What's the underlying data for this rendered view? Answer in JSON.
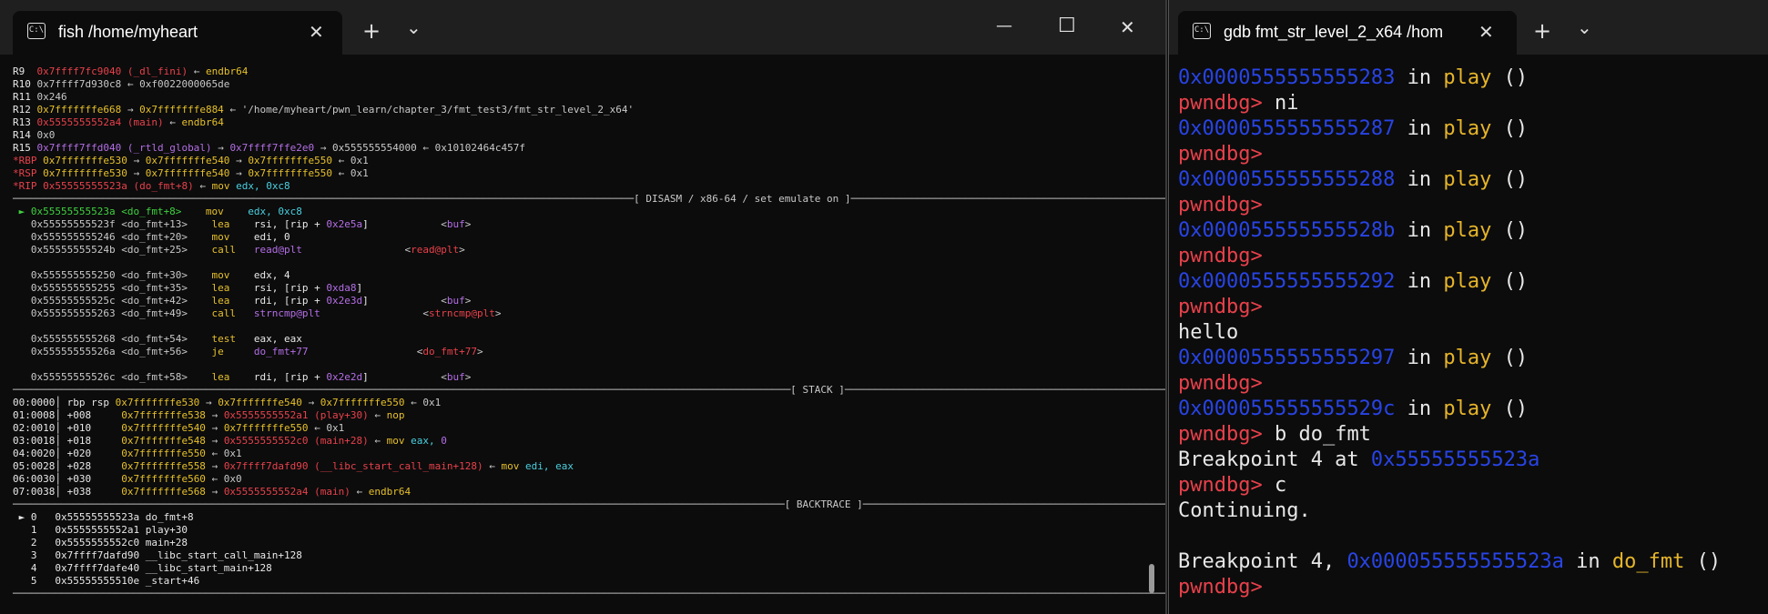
{
  "left_window": {
    "tab_title": "fish /home/myheart",
    "tab_icon": "terminal-icon",
    "tab_icon_text": "C:\\",
    "new_tab_label": "+",
    "dropdown_label": "⌄",
    "minimize_label": "—",
    "maximize_label": "☐",
    "close_label": "✕",
    "lines": [
      [
        {
          "t": "R9  ",
          "c": "white"
        },
        {
          "t": "0x7ffff7fc9040 (_dl_fini)",
          "c": "red"
        },
        {
          "t": " ← ",
          "c": "gray"
        },
        {
          "t": "endbr64",
          "c": "yellow"
        }
      ],
      [
        {
          "t": "R10 ",
          "c": "white"
        },
        {
          "t": "0x7ffff7d930c8 ← 0xf0022000065de",
          "c": "gray"
        }
      ],
      [
        {
          "t": "R11 ",
          "c": "white"
        },
        {
          "t": "0x246",
          "c": "gray"
        }
      ],
      [
        {
          "t": "R12 ",
          "c": "white"
        },
        {
          "t": "0x7fffffffe668",
          "c": "yellow"
        },
        {
          "t": " → ",
          "c": "gray"
        },
        {
          "t": "0x7fffffffe884",
          "c": "yellow"
        },
        {
          "t": " ← '/home/myheart/pwn_learn/chapter_3/fmt_test3/fmt_str_level_2_x64'",
          "c": "gray"
        }
      ],
      [
        {
          "t": "R13 ",
          "c": "white"
        },
        {
          "t": "0x5555555552a4 (main)",
          "c": "red"
        },
        {
          "t": " ← ",
          "c": "gray"
        },
        {
          "t": "endbr64",
          "c": "yellow"
        }
      ],
      [
        {
          "t": "R14 ",
          "c": "white"
        },
        {
          "t": "0x0",
          "c": "gray"
        }
      ],
      [
        {
          "t": "R15 ",
          "c": "white"
        },
        {
          "t": "0x7ffff7ffd040 (_rtld_global)",
          "c": "purple"
        },
        {
          "t": " → ",
          "c": "gray"
        },
        {
          "t": "0x7ffff7ffe2e0",
          "c": "purple"
        },
        {
          "t": " → 0x555555554000 ← 0x10102464c457f",
          "c": "gray"
        }
      ],
      [
        {
          "t": "*RBP ",
          "c": "red"
        },
        {
          "t": "0x7fffffffe530",
          "c": "yellow"
        },
        {
          "t": " → ",
          "c": "gray"
        },
        {
          "t": "0x7fffffffe540",
          "c": "yellow"
        },
        {
          "t": " → ",
          "c": "gray"
        },
        {
          "t": "0x7fffffffe550",
          "c": "yellow"
        },
        {
          "t": " ← 0x1",
          "c": "gray"
        }
      ],
      [
        {
          "t": "*RSP ",
          "c": "red"
        },
        {
          "t": "0x7fffffffe530",
          "c": "yellow"
        },
        {
          "t": " → ",
          "c": "gray"
        },
        {
          "t": "0x7fffffffe540",
          "c": "yellow"
        },
        {
          "t": " → ",
          "c": "gray"
        },
        {
          "t": "0x7fffffffe550",
          "c": "yellow"
        },
        {
          "t": " ← 0x1",
          "c": "gray"
        }
      ],
      [
        {
          "t": "*RIP ",
          "c": "red"
        },
        {
          "t": "0x55555555523a (do_fmt+8)",
          "c": "red"
        },
        {
          "t": " ← ",
          "c": "gray"
        },
        {
          "t": "mov ",
          "c": "yellow"
        },
        {
          "t": "edx, 0xc8",
          "c": "cyan"
        }
      ],
      [
        {
          "t": "───────────────────────────────────────────────────────────────────────────────────────────────────────[ DISASM / x86-64 / set emulate on ]─────────────────────────────────────────────────────────────────────────────────────────────────",
          "c": "sep"
        }
      ],
      [
        {
          "t": " ► 0x55555555523a <do_fmt+8>    ",
          "c": "green"
        },
        {
          "t": "mov    ",
          "c": "yellow"
        },
        {
          "t": "edx, 0xc8",
          "c": "cyan"
        }
      ],
      [
        {
          "t": "   0x55555555523f <do_fmt+13>    ",
          "c": "gray"
        },
        {
          "t": "lea    ",
          "c": "yellow"
        },
        {
          "t": "rsi, [rip + ",
          "c": "white"
        },
        {
          "t": "0x2e5a",
          "c": "purple"
        },
        {
          "t": "]            ",
          "c": "white"
        },
        {
          "t": "<",
          "c": "gray"
        },
        {
          "t": "buf",
          "c": "purple"
        },
        {
          "t": ">",
          "c": "gray"
        }
      ],
      [
        {
          "t": "   0x555555555246 <do_fmt+20>    ",
          "c": "gray"
        },
        {
          "t": "mov    ",
          "c": "yellow"
        },
        {
          "t": "edi, 0",
          "c": "white"
        }
      ],
      [
        {
          "t": "   0x55555555524b <do_fmt+25>    ",
          "c": "gray"
        },
        {
          "t": "call   ",
          "c": "yellow"
        },
        {
          "t": "read@plt",
          "c": "purple"
        },
        {
          "t": "                 <",
          "c": "gray"
        },
        {
          "t": "read@plt",
          "c": "red"
        },
        {
          "t": ">",
          "c": "gray"
        }
      ],
      [
        {
          "t": " ",
          "c": "gray"
        }
      ],
      [
        {
          "t": "   0x555555555250 <do_fmt+30>    ",
          "c": "gray"
        },
        {
          "t": "mov    ",
          "c": "yellow"
        },
        {
          "t": "edx, 4",
          "c": "white"
        }
      ],
      [
        {
          "t": "   0x555555555255 <do_fmt+35>    ",
          "c": "gray"
        },
        {
          "t": "lea    ",
          "c": "yellow"
        },
        {
          "t": "rsi, [rip + ",
          "c": "white"
        },
        {
          "t": "0xda8",
          "c": "purple"
        },
        {
          "t": "]",
          "c": "white"
        }
      ],
      [
        {
          "t": "   0x55555555525c <do_fmt+42>    ",
          "c": "gray"
        },
        {
          "t": "lea    ",
          "c": "yellow"
        },
        {
          "t": "rdi, [rip + ",
          "c": "white"
        },
        {
          "t": "0x2e3d",
          "c": "purple"
        },
        {
          "t": "]            ",
          "c": "white"
        },
        {
          "t": "<",
          "c": "gray"
        },
        {
          "t": "buf",
          "c": "purple"
        },
        {
          "t": ">",
          "c": "gray"
        }
      ],
      [
        {
          "t": "   0x555555555263 <do_fmt+49>    ",
          "c": "gray"
        },
        {
          "t": "call   ",
          "c": "yellow"
        },
        {
          "t": "strncmp@plt",
          "c": "purple"
        },
        {
          "t": "                 <",
          "c": "gray"
        },
        {
          "t": "strncmp@plt",
          "c": "red"
        },
        {
          "t": ">",
          "c": "gray"
        }
      ],
      [
        {
          "t": " ",
          "c": "gray"
        }
      ],
      [
        {
          "t": "   0x555555555268 <do_fmt+54>    ",
          "c": "gray"
        },
        {
          "t": "test   ",
          "c": "yellow"
        },
        {
          "t": "eax, eax",
          "c": "white"
        }
      ],
      [
        {
          "t": "   0x55555555526a <do_fmt+56>    ",
          "c": "gray"
        },
        {
          "t": "je     ",
          "c": "yellow"
        },
        {
          "t": "do_fmt+77",
          "c": "purple"
        },
        {
          "t": "                  <",
          "c": "gray"
        },
        {
          "t": "do_fmt+77",
          "c": "red"
        },
        {
          "t": ">",
          "c": "gray"
        }
      ],
      [
        {
          "t": " ",
          "c": "gray"
        }
      ],
      [
        {
          "t": "   0x55555555526c <do_fmt+58>    ",
          "c": "gray"
        },
        {
          "t": "lea    ",
          "c": "yellow"
        },
        {
          "t": "rdi, [rip + ",
          "c": "white"
        },
        {
          "t": "0x2e2d",
          "c": "purple"
        },
        {
          "t": "]            ",
          "c": "white"
        },
        {
          "t": "<",
          "c": "gray"
        },
        {
          "t": "buf",
          "c": "purple"
        },
        {
          "t": ">",
          "c": "gray"
        }
      ],
      [
        {
          "t": "─────────────────────────────────────────────────────────────────────────────────────────────────────────────────────────────────[ STACK ]─────────────────────────────────────────────────────────────────────────────────────────────────────",
          "c": "sep"
        }
      ],
      [
        {
          "t": "00:0000│ rbp rsp ",
          "c": "white"
        },
        {
          "t": "0x7fffffffe530",
          "c": "yellow"
        },
        {
          "t": " → ",
          "c": "gray"
        },
        {
          "t": "0x7fffffffe540",
          "c": "yellow"
        },
        {
          "t": " → ",
          "c": "gray"
        },
        {
          "t": "0x7fffffffe550",
          "c": "yellow"
        },
        {
          "t": " ← 0x1",
          "c": "gray"
        }
      ],
      [
        {
          "t": "01:0008│ +008     ",
          "c": "white"
        },
        {
          "t": "0x7fffffffe538",
          "c": "yellow"
        },
        {
          "t": " → ",
          "c": "gray"
        },
        {
          "t": "0x5555555552a1 (play+30)",
          "c": "red"
        },
        {
          "t": " ← ",
          "c": "gray"
        },
        {
          "t": "nop",
          "c": "yellow"
        }
      ],
      [
        {
          "t": "02:0010│ +010     ",
          "c": "white"
        },
        {
          "t": "0x7fffffffe540",
          "c": "yellow"
        },
        {
          "t": " → ",
          "c": "gray"
        },
        {
          "t": "0x7fffffffe550",
          "c": "yellow"
        },
        {
          "t": " ← 0x1",
          "c": "gray"
        }
      ],
      [
        {
          "t": "03:0018│ +018     ",
          "c": "white"
        },
        {
          "t": "0x7fffffffe548",
          "c": "yellow"
        },
        {
          "t": " → ",
          "c": "gray"
        },
        {
          "t": "0x5555555552c0 (main+28)",
          "c": "red"
        },
        {
          "t": " ← ",
          "c": "gray"
        },
        {
          "t": "mov ",
          "c": "yellow"
        },
        {
          "t": "eax, ",
          "c": "cyan"
        },
        {
          "t": "0",
          "c": "purple"
        }
      ],
      [
        {
          "t": "04:0020│ +020     ",
          "c": "white"
        },
        {
          "t": "0x7fffffffe550",
          "c": "yellow"
        },
        {
          "t": " ← 0x1",
          "c": "gray"
        }
      ],
      [
        {
          "t": "05:0028│ +028     ",
          "c": "white"
        },
        {
          "t": "0x7fffffffe558",
          "c": "yellow"
        },
        {
          "t": " → ",
          "c": "gray"
        },
        {
          "t": "0x7ffff7dafd90 (__libc_start_call_main+128)",
          "c": "red"
        },
        {
          "t": " ← ",
          "c": "gray"
        },
        {
          "t": "mov ",
          "c": "yellow"
        },
        {
          "t": "edi, eax",
          "c": "cyan"
        }
      ],
      [
        {
          "t": "06:0030│ +030     ",
          "c": "white"
        },
        {
          "t": "0x7fffffffe560",
          "c": "yellow"
        },
        {
          "t": " ← 0x0",
          "c": "gray"
        }
      ],
      [
        {
          "t": "07:0038│ +038     ",
          "c": "white"
        },
        {
          "t": "0x7fffffffe568",
          "c": "yellow"
        },
        {
          "t": " → ",
          "c": "gray"
        },
        {
          "t": "0x5555555552a4 (main)",
          "c": "red"
        },
        {
          "t": " ← ",
          "c": "gray"
        },
        {
          "t": "endbr64",
          "c": "yellow"
        }
      ],
      [
        {
          "t": "────────────────────────────────────────────────────────────────────────────────────────────────────────────────────────────────[ BACKTRACE ]───────────────────────────────────────────────────────────────────────────────────────────────────",
          "c": "sep"
        }
      ],
      [
        {
          "t": " ► 0   0x55555555523a do_fmt+8",
          "c": "white"
        }
      ],
      [
        {
          "t": "   1   0x5555555552a1 play+30",
          "c": "white"
        }
      ],
      [
        {
          "t": "   2   0x5555555552c0 main+28",
          "c": "white"
        }
      ],
      [
        {
          "t": "   3   0x7ffff7dafd90 __libc_start_call_main+128",
          "c": "white"
        }
      ],
      [
        {
          "t": "   4   0x7ffff7dafe40 __libc_start_main+128",
          "c": "white"
        }
      ],
      [
        {
          "t": "   5   0x55555555510e _start+46",
          "c": "white"
        }
      ],
      [
        {
          "t": "───────────────────────────────────────────────────────────────────────────────────────────────────────────────────────────────────────────────────────────────────────────────────────────────────────────────────────────────────────────────│",
          "c": "sep"
        }
      ]
    ]
  },
  "right_window": {
    "tab_title": "gdb fmt_str_level_2_x64 /hom",
    "tab_icon": "terminal-icon",
    "tab_icon_text": "C:\\",
    "new_tab_label": "+",
    "dropdown_label": "⌄",
    "close_label": "✕",
    "lines": [
      [
        {
          "t": "0x0000555555555283",
          "c": "blueaddr"
        },
        {
          "t": " in ",
          "c": "white"
        },
        {
          "t": "play",
          "c": "func"
        },
        {
          "t": " ()",
          "c": "white"
        }
      ],
      [
        {
          "t": "pwndbg> ",
          "c": "prompt"
        },
        {
          "t": "ni",
          "c": "white"
        }
      ],
      [
        {
          "t": "0x0000555555555287",
          "c": "blueaddr"
        },
        {
          "t": " in ",
          "c": "white"
        },
        {
          "t": "play",
          "c": "func"
        },
        {
          "t": " ()",
          "c": "white"
        }
      ],
      [
        {
          "t": "pwndbg>",
          "c": "prompt"
        }
      ],
      [
        {
          "t": "0x0000555555555288",
          "c": "blueaddr"
        },
        {
          "t": " in ",
          "c": "white"
        },
        {
          "t": "play",
          "c": "func"
        },
        {
          "t": " ()",
          "c": "white"
        }
      ],
      [
        {
          "t": "pwndbg>",
          "c": "prompt"
        }
      ],
      [
        {
          "t": "0x000055555555528b",
          "c": "blueaddr"
        },
        {
          "t": " in ",
          "c": "white"
        },
        {
          "t": "play",
          "c": "func"
        },
        {
          "t": " ()",
          "c": "white"
        }
      ],
      [
        {
          "t": "pwndbg>",
          "c": "prompt"
        }
      ],
      [
        {
          "t": "0x0000555555555292",
          "c": "blueaddr"
        },
        {
          "t": " in ",
          "c": "white"
        },
        {
          "t": "play",
          "c": "func"
        },
        {
          "t": " ()",
          "c": "white"
        }
      ],
      [
        {
          "t": "pwndbg>",
          "c": "prompt"
        }
      ],
      [
        {
          "t": "hello",
          "c": "white"
        }
      ],
      [
        {
          "t": "0x0000555555555297",
          "c": "blueaddr"
        },
        {
          "t": " in ",
          "c": "white"
        },
        {
          "t": "play",
          "c": "func"
        },
        {
          "t": " ()",
          "c": "white"
        }
      ],
      [
        {
          "t": "pwndbg>",
          "c": "prompt"
        }
      ],
      [
        {
          "t": "0x000055555555529c",
          "c": "blueaddr"
        },
        {
          "t": " in ",
          "c": "white"
        },
        {
          "t": "play",
          "c": "func"
        },
        {
          "t": " ()",
          "c": "white"
        }
      ],
      [
        {
          "t": "pwndbg> ",
          "c": "prompt"
        },
        {
          "t": "b do_fmt",
          "c": "white"
        }
      ],
      [
        {
          "t": "Breakpoint 4 at ",
          "c": "white"
        },
        {
          "t": "0x55555555523a",
          "c": "blueaddr"
        }
      ],
      [
        {
          "t": "pwndbg> ",
          "c": "prompt"
        },
        {
          "t": "c",
          "c": "white"
        }
      ],
      [
        {
          "t": "Continuing.",
          "c": "white"
        }
      ],
      [
        {
          "t": " ",
          "c": "white"
        }
      ],
      [
        {
          "t": "Breakpoint 4, ",
          "c": "white"
        },
        {
          "t": "0x000055555555523a",
          "c": "blueaddr"
        },
        {
          "t": " in ",
          "c": "white"
        },
        {
          "t": "do_fmt",
          "c": "func"
        },
        {
          "t": " ()",
          "c": "white"
        }
      ],
      [
        {
          "t": "pwndbg>",
          "c": "prompt"
        }
      ]
    ]
  }
}
